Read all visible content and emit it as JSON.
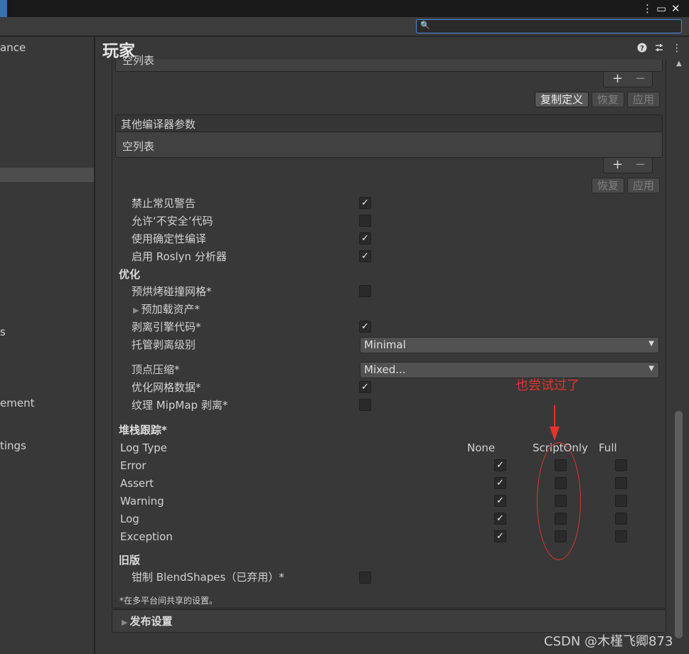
{
  "window": {
    "more_icon": "⋮",
    "maximize_icon": "▭",
    "close_icon": "✕"
  },
  "search": {
    "placeholder": "",
    "icon": "search-icon"
  },
  "sidebar": {
    "items": [
      {
        "label": "ance"
      },
      {
        "label": "s"
      },
      {
        "label": "ement"
      },
      {
        "label": "tings"
      }
    ]
  },
  "header": {
    "title": "玩家"
  },
  "top_list": {
    "empty_text": "空列表",
    "add": "+",
    "remove": "−",
    "buttons": [
      "复制定义",
      "恢复",
      "应用"
    ]
  },
  "compiler_list": {
    "title": "其他编译器参数",
    "empty_text": "空列表",
    "add": "+",
    "remove": "−",
    "buttons": [
      "恢复",
      "应用"
    ]
  },
  "settings": {
    "suppress_warnings": {
      "label": "禁止常见警告",
      "checked": true
    },
    "unsafe_code": {
      "label": "允许‘不安全’代码",
      "checked": false
    },
    "deterministic": {
      "label": "使用确定性编译",
      "checked": true
    },
    "roslyn": {
      "label": "启用 Roslyn 分析器",
      "checked": true
    }
  },
  "optimization": {
    "title": "优化",
    "prebake": {
      "label": "预烘烤碰撞网格*",
      "checked": false
    },
    "preload": {
      "label": "预加载资产*"
    },
    "strip_engine": {
      "label": "剥离引擎代码*",
      "checked": true
    },
    "managed_strip": {
      "label": "托管剥离级别",
      "value": "Minimal"
    },
    "vertex_compression": {
      "label": "顶点压缩*",
      "value": "Mixed..."
    },
    "optimize_mesh": {
      "label": "优化网格数据*",
      "checked": true
    },
    "mipmap_strip": {
      "label": "纹理 MipMap 剥离*",
      "checked": false
    }
  },
  "stack_trace": {
    "title": "堆栈跟踪*",
    "columns": [
      "Log Type",
      "None",
      "ScriptOnly",
      "Full"
    ],
    "rows": [
      {
        "name": "Error"
      },
      {
        "name": "Assert"
      },
      {
        "name": "Warning"
      },
      {
        "name": "Log"
      },
      {
        "name": "Exception"
      }
    ]
  },
  "legacy": {
    "title": "旧版",
    "blendshapes": {
      "label": "钳制 BlendShapes（已弃用）*",
      "checked": false
    }
  },
  "shared_note": "*在多平台间共享的设置。",
  "publish": {
    "title": "发布设置"
  },
  "annotation": {
    "text": "也尝试过了",
    "color": "#e4332c"
  },
  "watermark": "CSDN @木槿飞卿873"
}
